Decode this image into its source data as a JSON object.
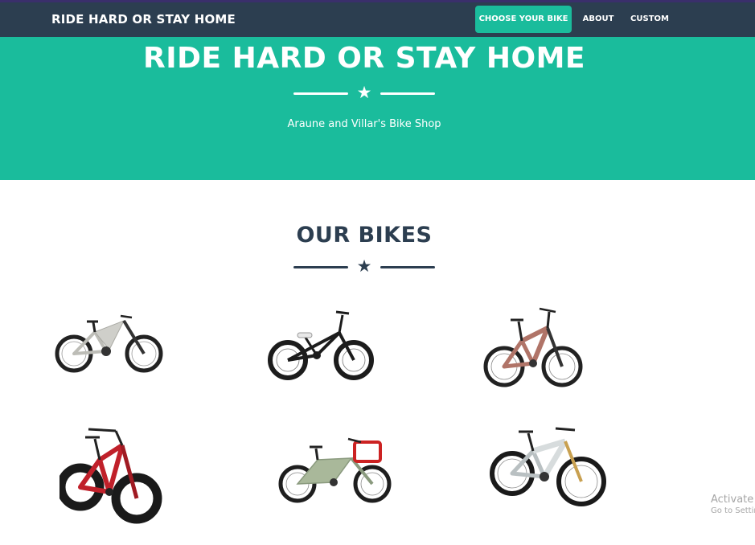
{
  "navbar": {
    "brand": "RIDE HARD OR STAY HOME",
    "links": [
      {
        "label": "CHOOSE YOUR BIKE",
        "active": true
      },
      {
        "label": "ABOUT",
        "active": false
      },
      {
        "label": "CUSTOM",
        "active": false
      }
    ]
  },
  "masthead": {
    "title": "RIDE HARD OR STAY HOME",
    "subtitle": "Araune and Villar's Bike Shop",
    "divider_icon": "star-icon"
  },
  "bikes_section": {
    "title": "OUR BIKES",
    "divider_icon": "star-icon",
    "bikes": [
      {
        "kind": "electric mountain bike",
        "frame_color": "#c8c8c2"
      },
      {
        "kind": "bmx bike",
        "frame_color": "#1c1c1c"
      },
      {
        "kind": "enduro mountain bike",
        "frame_color": "#b07468"
      },
      {
        "kind": "fat bike",
        "frame_color": "#c0202a"
      },
      {
        "kind": "cargo e-bike",
        "frame_color": "#a9b89a"
      },
      {
        "kind": "trail mountain bike",
        "frame_color": "#d7dcdd"
      }
    ]
  },
  "watermark": {
    "line1": "Activate V",
    "line2": "Go to Settin"
  },
  "colors": {
    "navbar_bg": "#2c3e50",
    "accent": "#1abc9c",
    "heading": "#2c3e50",
    "top_accent": "#3a2f6b"
  }
}
